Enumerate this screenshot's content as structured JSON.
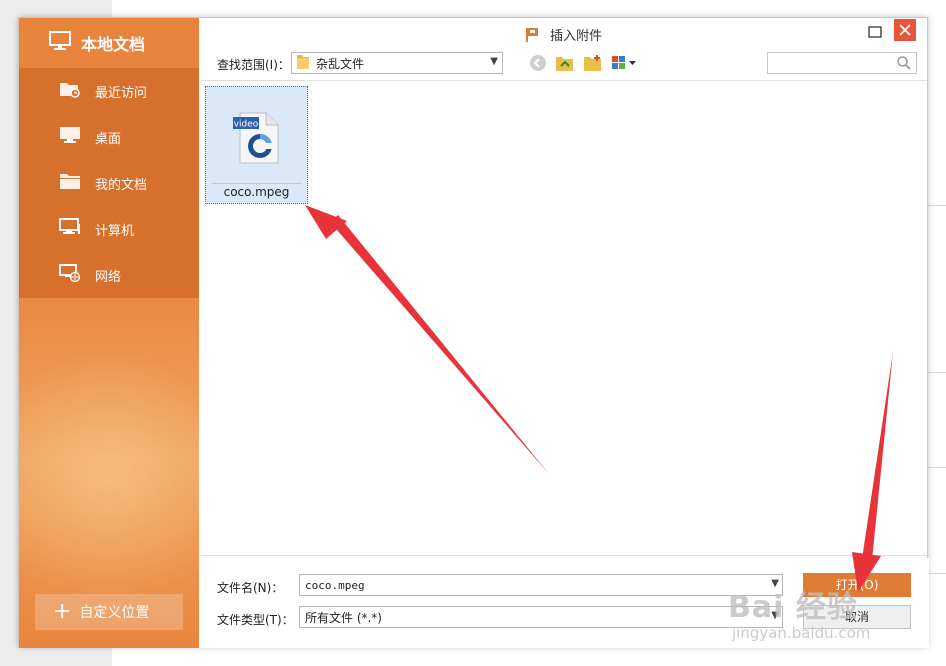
{
  "sidebar": {
    "title": "本地文档",
    "items": [
      {
        "label": "最近访问",
        "icon": "recent-folder-icon"
      },
      {
        "label": "桌面",
        "icon": "desktop-icon"
      },
      {
        "label": "我的文档",
        "icon": "documents-folder-icon"
      },
      {
        "label": "计算机",
        "icon": "computer-icon"
      },
      {
        "label": "网络",
        "icon": "network-icon"
      }
    ],
    "custom_location": "自定义位置"
  },
  "dialog": {
    "title": "插入附件"
  },
  "toolbar": {
    "look_in_label": "查找范围(I)：",
    "look_in_value": "杂乱文件",
    "search_placeholder": ""
  },
  "files": [
    {
      "name": "coco.mpeg",
      "badge": "video",
      "selected": true
    }
  ],
  "bottom": {
    "filename_label": "文件名(N)：",
    "filename_value": "coco.mpeg",
    "filetype_label": "文件类型(T)：",
    "filetype_value": "所有文件 (*.*)",
    "open_label": "打开(O)",
    "cancel_label": "取消"
  },
  "watermark": {
    "brand": "Bai 经验",
    "url": "jingyan.baidu.com"
  },
  "colors": {
    "accent": "#e07b36",
    "sidebar": "#e8833c",
    "close": "#e8553a",
    "arrow": "#e8333a"
  }
}
